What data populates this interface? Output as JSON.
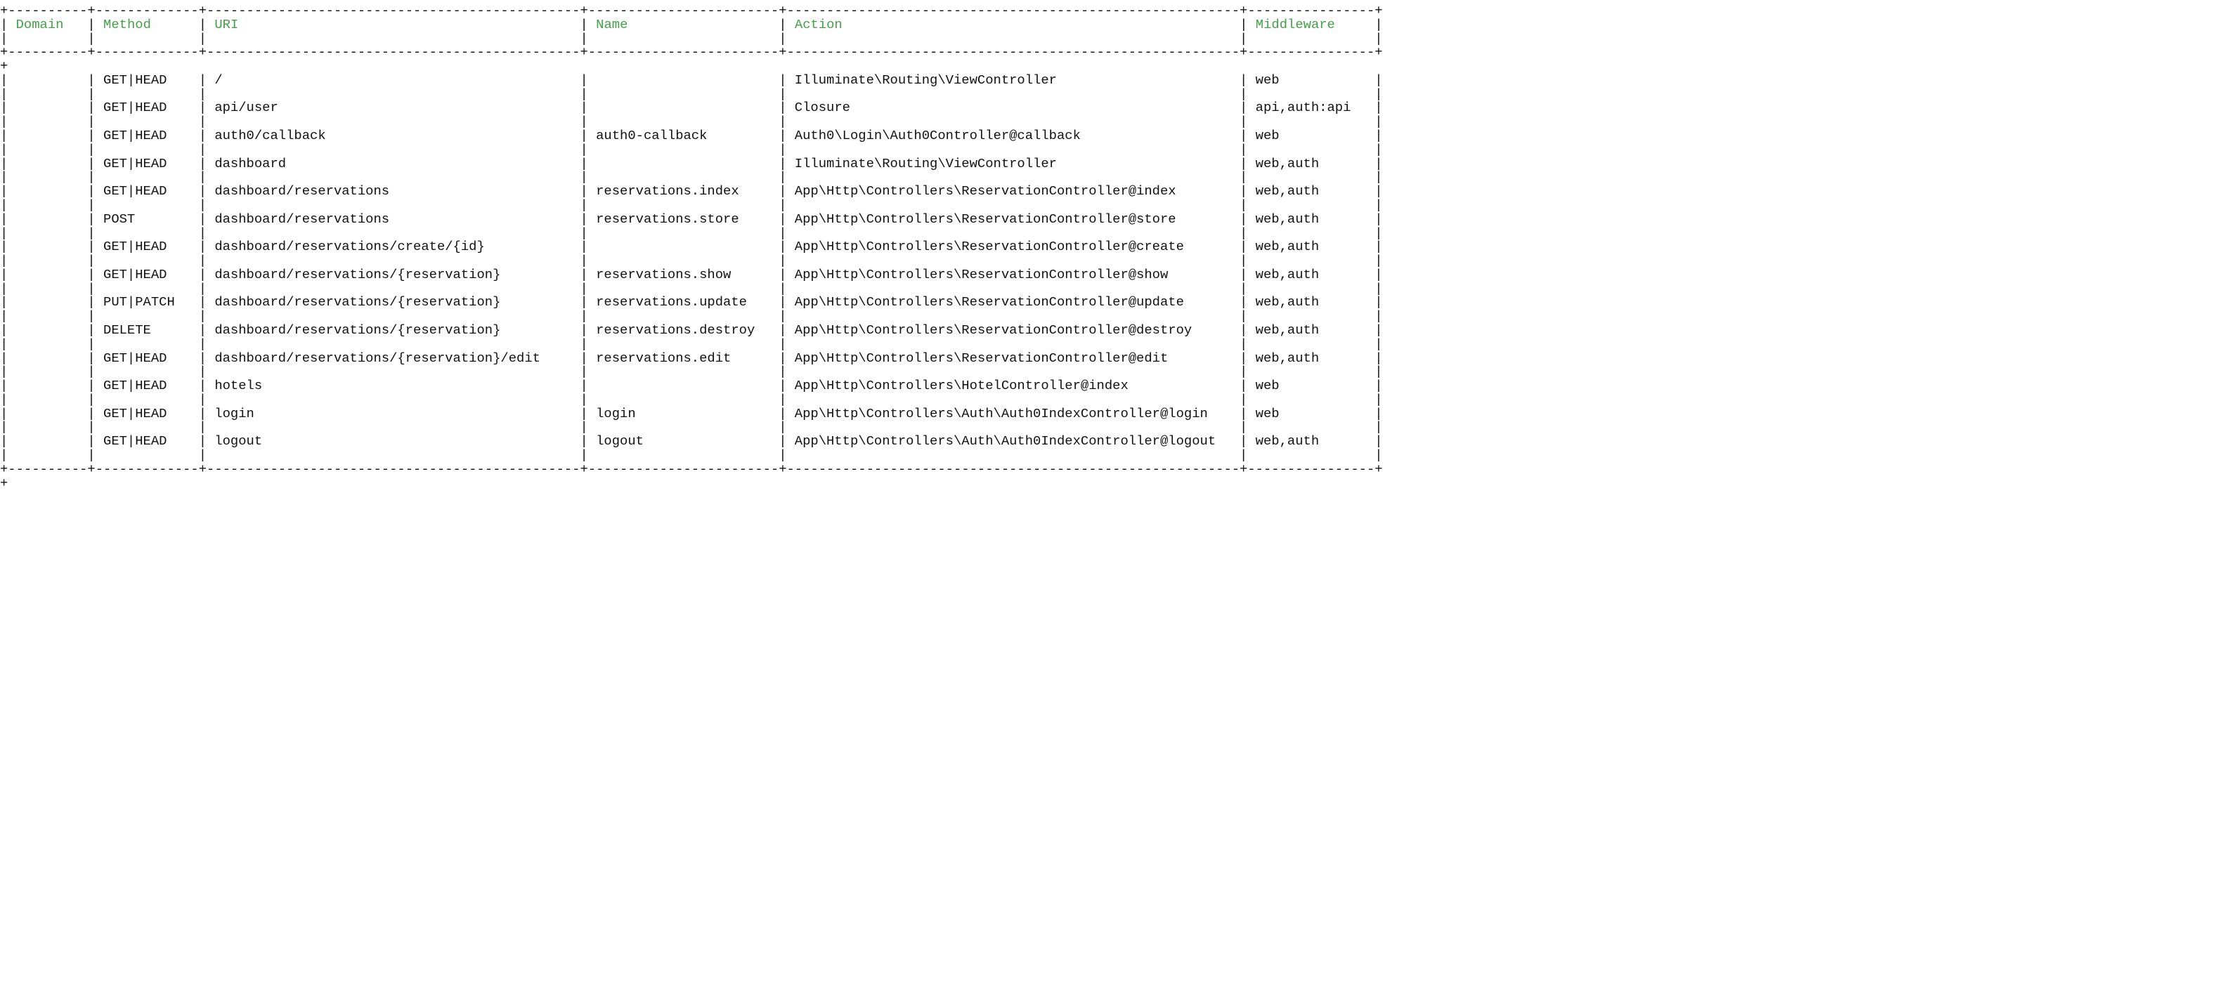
{
  "headers": {
    "domain": "Domain",
    "method": "Method",
    "uri": "URI",
    "name": "Name",
    "action": "Action",
    "middleware": "Middleware"
  },
  "col_widths": {
    "domain": 8,
    "method": 11,
    "uri": 45,
    "name": 22,
    "action": 55,
    "middleware": 14
  },
  "rows": [
    {
      "domain": "",
      "method": "GET|HEAD",
      "uri": "/",
      "name": "",
      "action": "Illuminate\\Routing\\ViewController",
      "middleware": "web"
    },
    {
      "domain": "",
      "method": "GET|HEAD",
      "uri": "api/user",
      "name": "",
      "action": "Closure",
      "middleware": "api,auth:api"
    },
    {
      "domain": "",
      "method": "GET|HEAD",
      "uri": "auth0/callback",
      "name": "auth0-callback",
      "action": "Auth0\\Login\\Auth0Controller@callback",
      "middleware": "web"
    },
    {
      "domain": "",
      "method": "GET|HEAD",
      "uri": "dashboard",
      "name": "",
      "action": "Illuminate\\Routing\\ViewController",
      "middleware": "web,auth"
    },
    {
      "domain": "",
      "method": "GET|HEAD",
      "uri": "dashboard/reservations",
      "name": "reservations.index",
      "action": "App\\Http\\Controllers\\ReservationController@index",
      "middleware": "web,auth"
    },
    {
      "domain": "",
      "method": "POST",
      "uri": "dashboard/reservations",
      "name": "reservations.store",
      "action": "App\\Http\\Controllers\\ReservationController@store",
      "middleware": "web,auth"
    },
    {
      "domain": "",
      "method": "GET|HEAD",
      "uri": "dashboard/reservations/create/{id}",
      "name": "",
      "action": "App\\Http\\Controllers\\ReservationController@create",
      "middleware": "web,auth"
    },
    {
      "domain": "",
      "method": "GET|HEAD",
      "uri": "dashboard/reservations/{reservation}",
      "name": "reservations.show",
      "action": "App\\Http\\Controllers\\ReservationController@show",
      "middleware": "web,auth"
    },
    {
      "domain": "",
      "method": "PUT|PATCH",
      "uri": "dashboard/reservations/{reservation}",
      "name": "reservations.update",
      "action": "App\\Http\\Controllers\\ReservationController@update",
      "middleware": "web,auth"
    },
    {
      "domain": "",
      "method": "DELETE",
      "uri": "dashboard/reservations/{reservation}",
      "name": "reservations.destroy",
      "action": "App\\Http\\Controllers\\ReservationController@destroy",
      "middleware": "web,auth"
    },
    {
      "domain": "",
      "method": "GET|HEAD",
      "uri": "dashboard/reservations/{reservation}/edit",
      "name": "reservations.edit",
      "action": "App\\Http\\Controllers\\ReservationController@edit",
      "middleware": "web,auth"
    },
    {
      "domain": "",
      "method": "GET|HEAD",
      "uri": "hotels",
      "name": "",
      "action": "App\\Http\\Controllers\\HotelController@index",
      "middleware": "web"
    },
    {
      "domain": "",
      "method": "GET|HEAD",
      "uri": "login",
      "name": "login",
      "action": "App\\Http\\Controllers\\Auth\\Auth0IndexController@login",
      "middleware": "web"
    },
    {
      "domain": "",
      "method": "GET|HEAD",
      "uri": "logout",
      "name": "logout",
      "action": "App\\Http\\Controllers\\Auth\\Auth0IndexController@logout",
      "middleware": "web,auth"
    }
  ]
}
